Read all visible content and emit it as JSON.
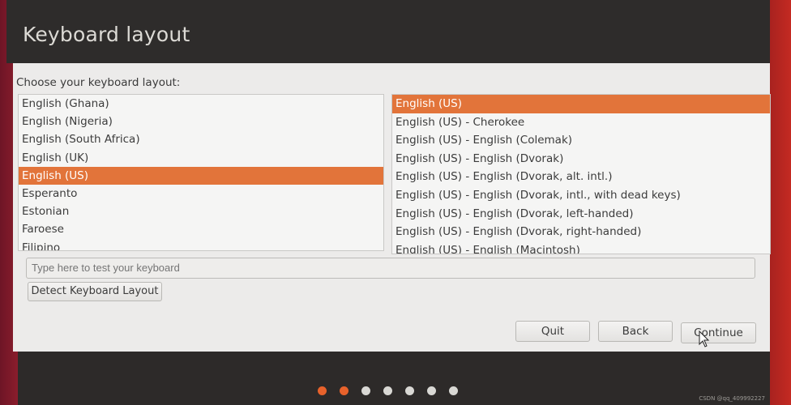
{
  "header": {
    "title": "Keyboard layout"
  },
  "main": {
    "prompt": "Choose your keyboard layout:",
    "layouts": [
      {
        "label": "English (Ghana)",
        "selected": false
      },
      {
        "label": "English (Nigeria)",
        "selected": false
      },
      {
        "label": "English (South Africa)",
        "selected": false
      },
      {
        "label": "English (UK)",
        "selected": false
      },
      {
        "label": "English (US)",
        "selected": true
      },
      {
        "label": "Esperanto",
        "selected": false
      },
      {
        "label": "Estonian",
        "selected": false
      },
      {
        "label": "Faroese",
        "selected": false
      },
      {
        "label": "Filipino",
        "selected": false
      }
    ],
    "variants": [
      {
        "label": "English (US)",
        "selected": true
      },
      {
        "label": "English (US) - Cherokee",
        "selected": false
      },
      {
        "label": "English (US) - English (Colemak)",
        "selected": false
      },
      {
        "label": "English (US) - English (Dvorak)",
        "selected": false
      },
      {
        "label": "English (US) - English (Dvorak, alt. intl.)",
        "selected": false
      },
      {
        "label": "English (US) - English (Dvorak, intl., with dead keys)",
        "selected": false
      },
      {
        "label": "English (US) - English (Dvorak, left-handed)",
        "selected": false
      },
      {
        "label": "English (US) - English (Dvorak, right-handed)",
        "selected": false
      },
      {
        "label": "English (US) - English (Macintosh)",
        "selected": false
      }
    ],
    "test_input": {
      "value": "",
      "placeholder": "Type here to test your keyboard"
    },
    "detect_label": "Detect Keyboard Layout"
  },
  "footer": {
    "quit_label": "Quit",
    "back_label": "Back",
    "continue_label": "Continue"
  },
  "progress": {
    "total_steps": 7,
    "completed_steps": 2
  },
  "colors": {
    "accent": "#e2743a",
    "progress_done": "#e8622b"
  },
  "watermark": "CSDN @qq_409992227"
}
